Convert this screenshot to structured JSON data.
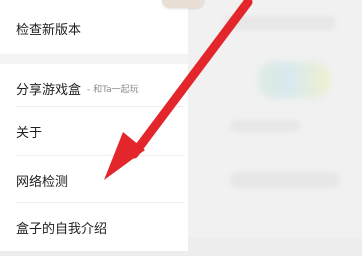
{
  "menu": {
    "items": [
      {
        "label": "检查新版本"
      },
      {
        "label": "分享游戏盒",
        "sublabel": "- 和Ta一起玩"
      },
      {
        "label": "关于"
      },
      {
        "label": "网络检测"
      },
      {
        "label": "盒子的自我介绍"
      }
    ]
  },
  "colors": {
    "arrow": "#e3262c",
    "panel_background": "#ffffff",
    "page_background": "#f3f3f3",
    "secondary_text": "#8d8d8d"
  }
}
